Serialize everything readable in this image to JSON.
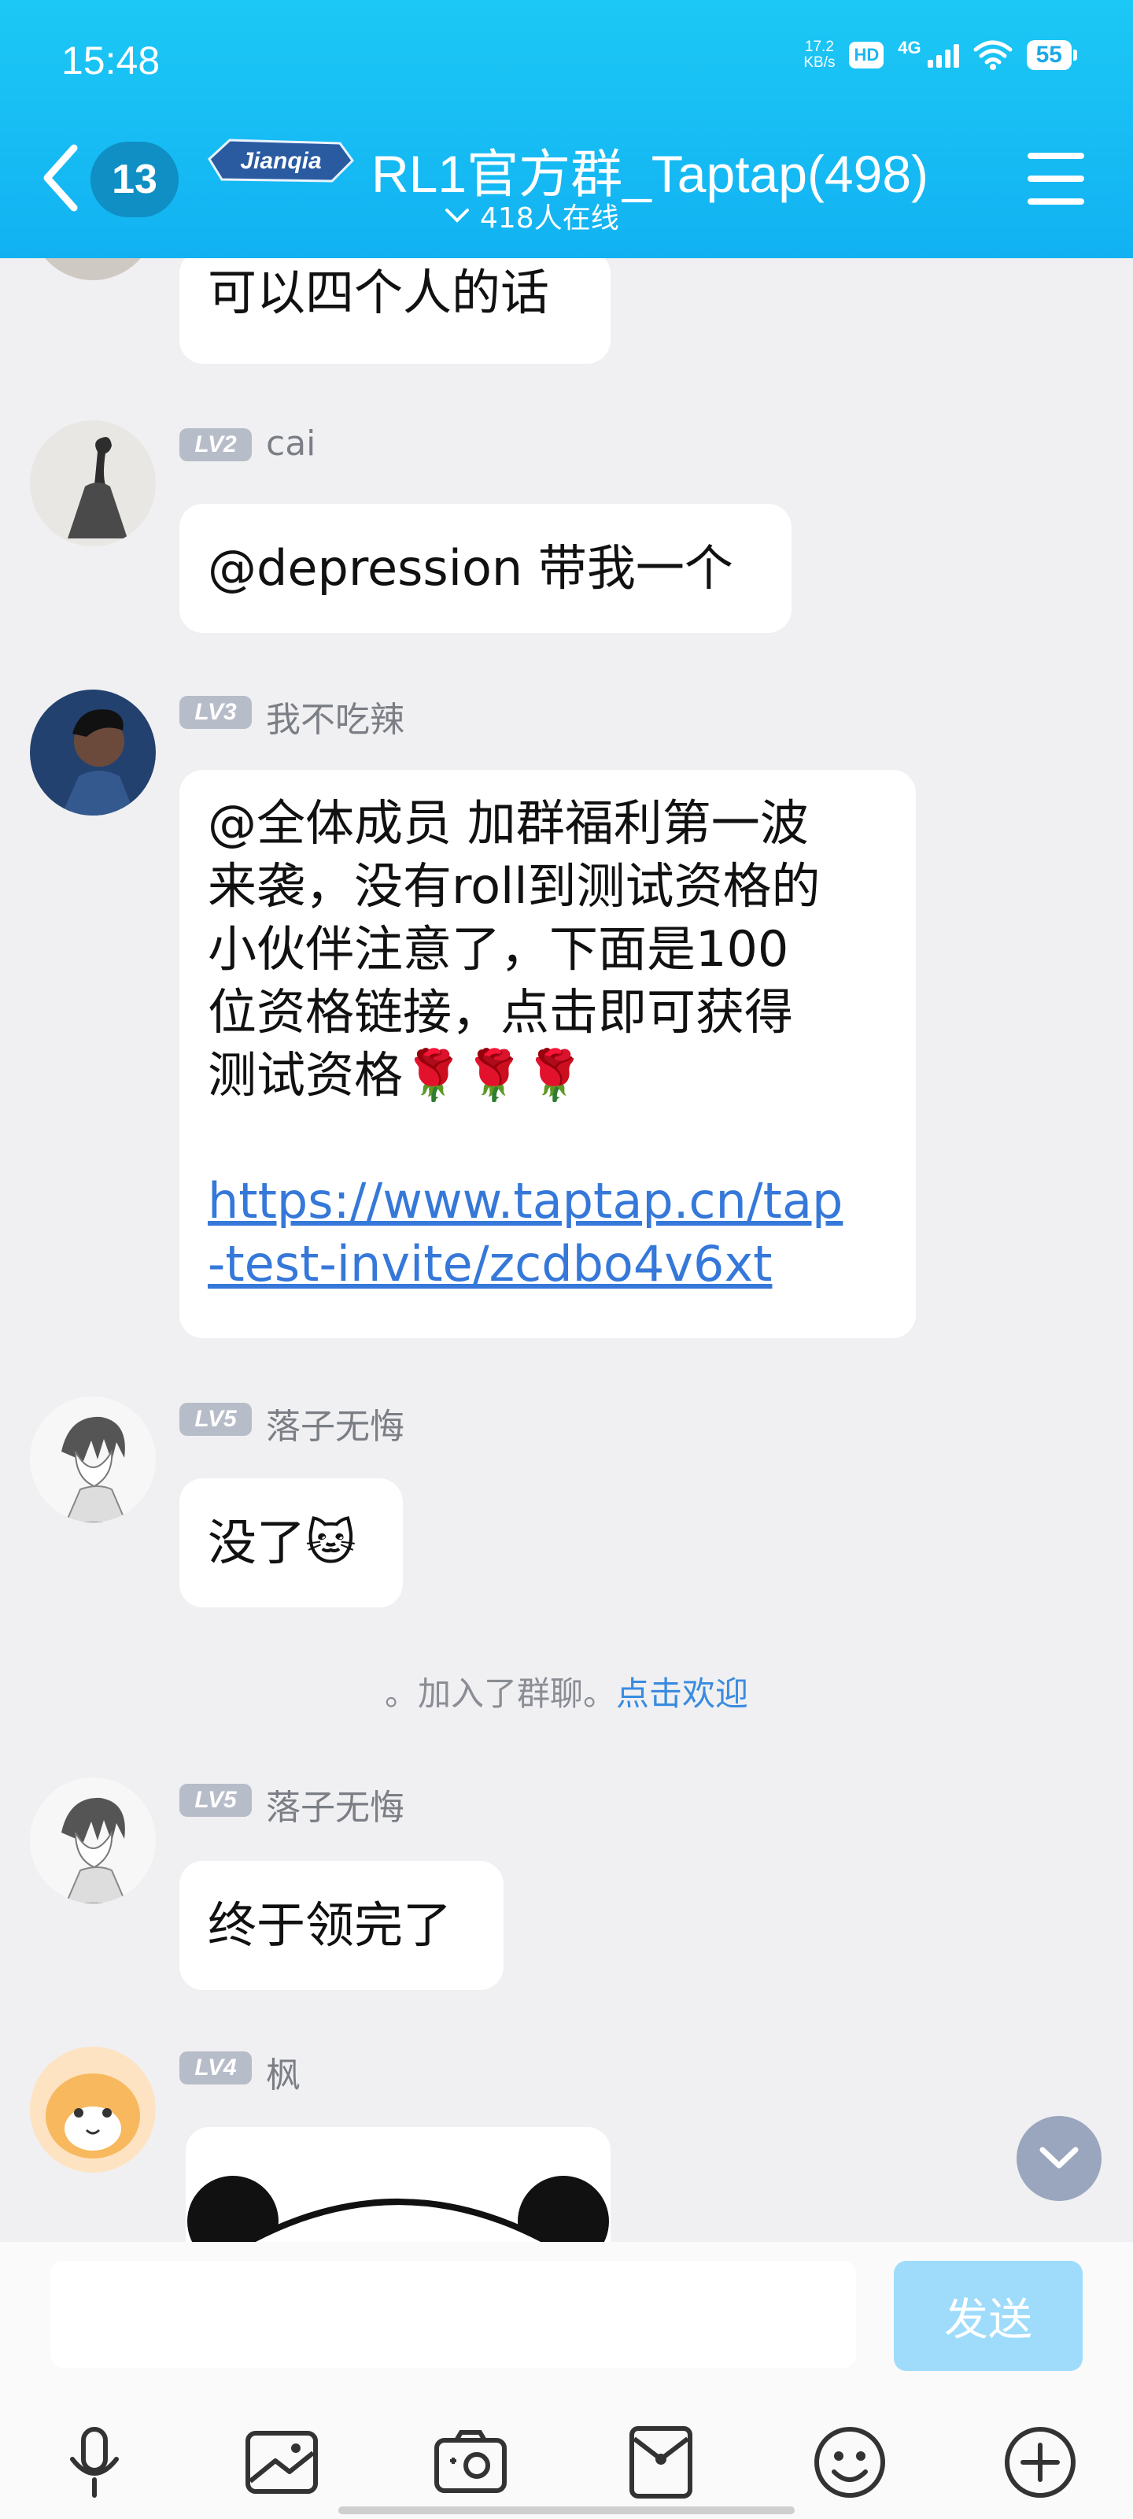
{
  "status_bar": {
    "time": "15:48",
    "net_speed_value": "17.2",
    "net_speed_unit": "KB/s",
    "hd": "HD",
    "network": "4G",
    "battery": "55"
  },
  "header": {
    "back_unread_count": "13",
    "title": "RL1官方群_Taptap(498)",
    "online": "418人在线",
    "logo_text": "Jianqia"
  },
  "messages": {
    "m0": {
      "text": "可以四个人的话"
    },
    "m1": {
      "level": "LV2",
      "sender": "cai",
      "text": "@depression 带我一个"
    },
    "m2": {
      "level": "LV3",
      "sender": "我不吃辣",
      "lines": [
        "@全体成员 加群福利第一波",
        "来袭，没有roll到测试资格的",
        "小伙伴注意了，下面是100",
        "位资格链接，点击即可获得",
        "测试资格🌹🌹🌹"
      ],
      "link_lines": [
        "https://www.taptap.cn/tap",
        "-test-invite/zcdbo4v6xt"
      ]
    },
    "m3": {
      "level": "LV5",
      "sender": "落子无悔",
      "text": "没了🐱"
    },
    "system": {
      "text": "。加入了群聊。",
      "action": "点击欢迎"
    },
    "m4": {
      "level": "LV5",
      "sender": "落子无悔",
      "text": "终于领完了"
    },
    "m5": {
      "level": "LV4",
      "sender": "枫"
    }
  },
  "input_bar": {
    "placeholder": "",
    "send_label": "发送"
  },
  "colors": {
    "header": "#12b2f2",
    "link": "#3578d9",
    "send_disabled": "#9fdcfb",
    "level_badge": "#b7bcc9"
  },
  "icons": [
    "back-arrow-icon",
    "chevron-down-icon",
    "menu-icon",
    "microphone-icon",
    "image-icon",
    "camera-icon",
    "red-packet-icon",
    "emoji-icon",
    "plus-icon",
    "scroll-down-icon"
  ]
}
